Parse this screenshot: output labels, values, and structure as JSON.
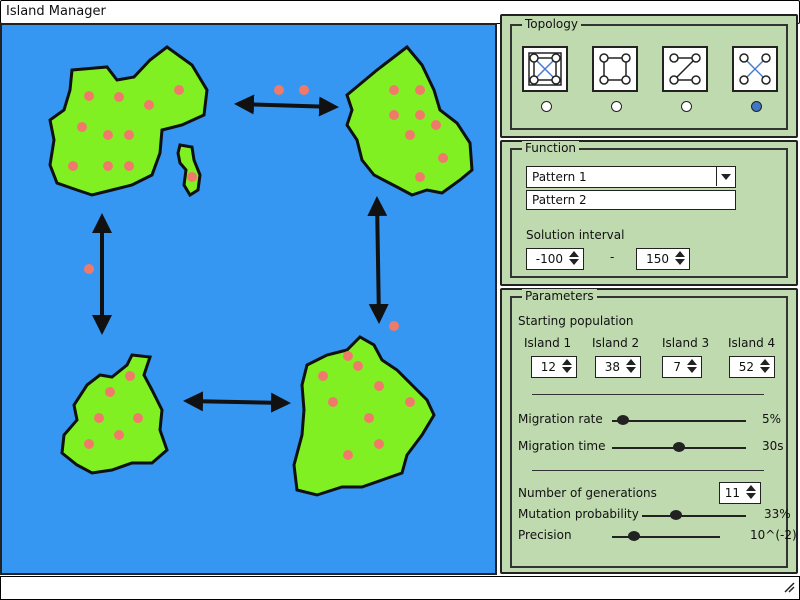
{
  "window": {
    "title": "Island Manager"
  },
  "topology": {
    "title": "Topology",
    "options": [
      {
        "icon": "topology-full-mesh-icon",
        "selected": false
      },
      {
        "icon": "topology-grid-icon",
        "selected": false
      },
      {
        "icon": "topology-chain-icon",
        "selected": false
      },
      {
        "icon": "topology-cross-icon",
        "selected": true
      }
    ]
  },
  "function": {
    "title": "Function",
    "selected": "Pattern 1",
    "option": "Pattern 2",
    "interval_label": "Solution interval",
    "min": "-100",
    "separator": "-",
    "max": "150"
  },
  "parameters": {
    "title": "Parameters",
    "starting_population_label": "Starting population",
    "islands": [
      {
        "label": "Island 1",
        "value": "12"
      },
      {
        "label": "Island 2",
        "value": "38"
      },
      {
        "label": "Island 3",
        "value": "7"
      },
      {
        "label": "Island 4",
        "value": "52"
      }
    ],
    "migration_rate": {
      "label": "Migration rate",
      "value": "5%",
      "level": 0.08
    },
    "migration_time": {
      "label": "Migration time",
      "value": "30s",
      "level": 0.5
    },
    "generations": {
      "label": "Number of generations",
      "value": "11"
    },
    "mutation_probability": {
      "label": "Mutation probability",
      "value": "33%",
      "level": 0.33
    },
    "precision": {
      "label": "Precision",
      "value": "10^(-2)",
      "level": 0.2
    }
  },
  "colors": {
    "sea": "#3597f2",
    "land": "#80f023",
    "individual": "#f07a6a",
    "panel": "#c0dab0"
  }
}
